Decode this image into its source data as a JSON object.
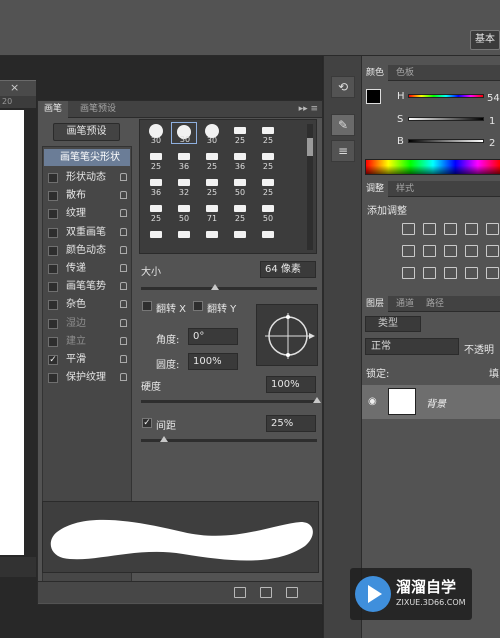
{
  "topbar": {
    "workspace": "基本"
  },
  "document": {
    "ruler_value": "20"
  },
  "brush_panel": {
    "tabs": [
      "画笔",
      "画笔预设"
    ],
    "preset_button": "画笔预设",
    "tip_shape_label": "画笔笔尖形状",
    "options": [
      {
        "label": "形状动态",
        "checked": false,
        "dim": false
      },
      {
        "label": "散布",
        "checked": false,
        "dim": false
      },
      {
        "label": "纹理",
        "checked": false,
        "dim": false
      },
      {
        "label": "双重画笔",
        "checked": false,
        "dim": false
      },
      {
        "label": "颜色动态",
        "checked": false,
        "dim": false
      },
      {
        "label": "传递",
        "checked": false,
        "dim": false
      },
      {
        "label": "画笔笔势",
        "checked": false,
        "dim": false
      },
      {
        "label": "杂色",
        "checked": false,
        "dim": false
      },
      {
        "label": "湿边",
        "checked": false,
        "dim": true
      },
      {
        "label": "建立",
        "checked": false,
        "dim": true
      },
      {
        "label": "平滑",
        "checked": true,
        "dim": false
      },
      {
        "label": "保护纹理",
        "checked": false,
        "dim": false
      }
    ],
    "tips": [
      {
        "size": "30",
        "kind": "round"
      },
      {
        "size": "30",
        "kind": "round"
      },
      {
        "size": "30",
        "kind": "round"
      },
      {
        "size": "25",
        "kind": "flat"
      },
      {
        "size": "25",
        "kind": "flat"
      },
      {
        "size": "25",
        "kind": "flat"
      },
      {
        "size": "36",
        "kind": "flat"
      },
      {
        "size": "25",
        "kind": "flat"
      },
      {
        "size": "36",
        "kind": "flat"
      },
      {
        "size": "25",
        "kind": "flat"
      },
      {
        "size": "36",
        "kind": "flat"
      },
      {
        "size": "32",
        "kind": "flat"
      },
      {
        "size": "25",
        "kind": "flat"
      },
      {
        "size": "50",
        "kind": "flat"
      },
      {
        "size": "25",
        "kind": "flat"
      },
      {
        "size": "25",
        "kind": "flat"
      },
      {
        "size": "50",
        "kind": "flat"
      },
      {
        "size": "71",
        "kind": "flat"
      },
      {
        "size": "25",
        "kind": "flat"
      },
      {
        "size": "50",
        "kind": "flat"
      },
      {
        "size": "",
        "kind": "flat"
      },
      {
        "size": "",
        "kind": "flat"
      },
      {
        "size": "",
        "kind": "flat"
      },
      {
        "size": "",
        "kind": "flat"
      },
      {
        "size": "",
        "kind": "flat"
      }
    ],
    "size_label": "大小",
    "size_value": "64 像素",
    "size_level": 0.42,
    "flip_x_label": "翻转 X",
    "flip_y_label": "翻转 Y",
    "angle_label": "角度:",
    "angle_value": "0°",
    "roundness_label": "圆度:",
    "roundness_value": "100%",
    "hardness_label": "硬度",
    "hardness_value": "100%",
    "hardness_level": 1.0,
    "spacing_label": "间距",
    "spacing_checked": true,
    "spacing_value": "25%",
    "spacing_level": 0.13
  },
  "color_panel": {
    "tabs": [
      "颜色",
      "色板"
    ],
    "h_label": "H",
    "h_value": "54",
    "s_label": "S",
    "s_value": "1",
    "b_label": "B",
    "b_value": "2"
  },
  "adjust_panel": {
    "tabs": [
      "调整",
      "样式"
    ],
    "title": "添加调整"
  },
  "layers_panel": {
    "tabs": [
      "图层",
      "通道",
      "路径"
    ],
    "filter_kind": "类型",
    "blend_mode": "正常",
    "opacity_label": "不透明",
    "lock_label": "锁定:",
    "fill_label": "填",
    "layer_name": "背景"
  },
  "watermark": {
    "brand": "溜溜自学",
    "url": "ZIXUE.3D66.COM"
  }
}
